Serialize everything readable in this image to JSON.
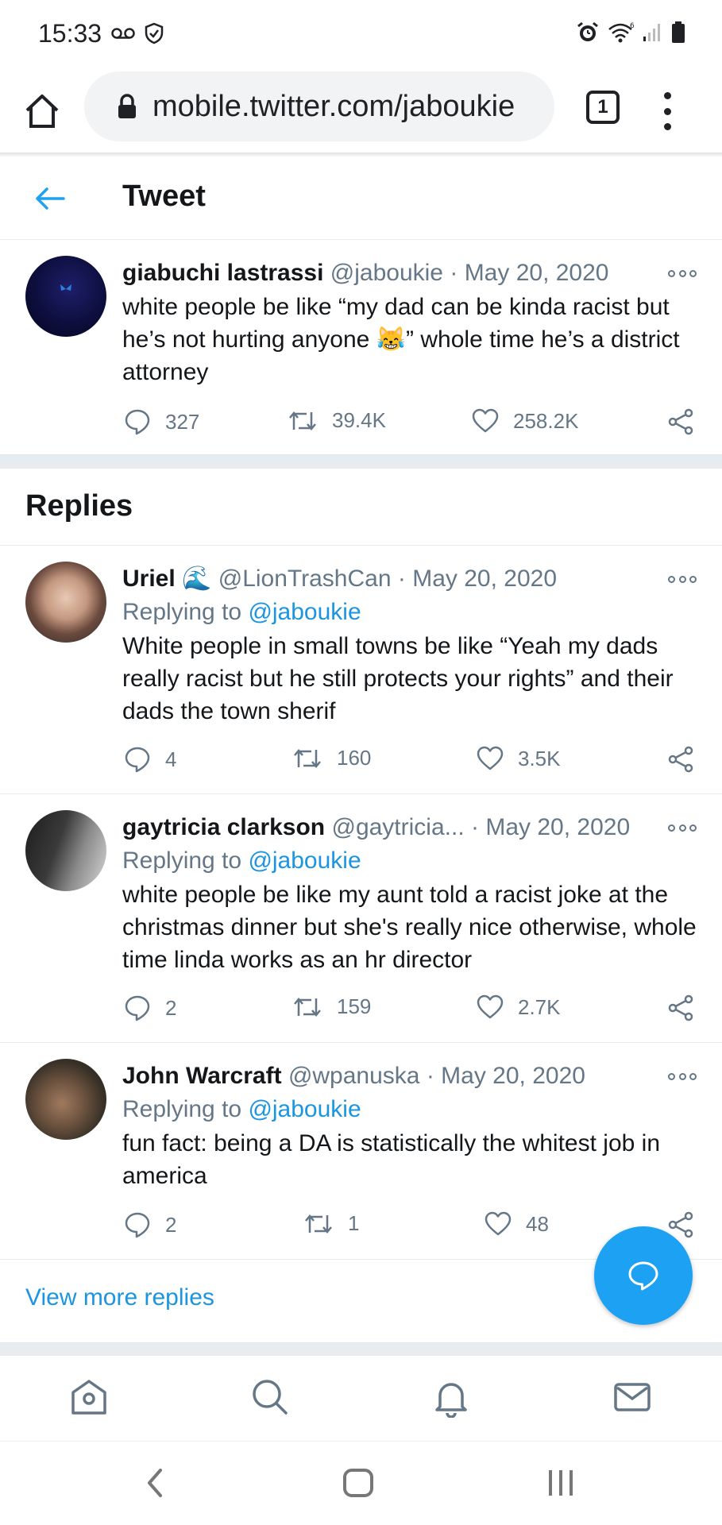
{
  "status_bar": {
    "time": "15:33",
    "icons": [
      "voicemail-icon",
      "shield-icon",
      "alarm-icon",
      "wifi-icon",
      "signal-icon",
      "battery-icon"
    ]
  },
  "browser": {
    "url": "mobile.twitter.com/jaboukie",
    "tab_count": "1"
  },
  "header": {
    "title": "Tweet"
  },
  "main_tweet": {
    "name": "giabuchi lastrassi",
    "handle": "@jaboukie",
    "sep": "·",
    "date": "May 20, 2020",
    "text_before_emoji": "white people be like “my dad can be kinda racist but he’s not hurting anyone ",
    "emoji": "😹",
    "text_after_emoji": "” whole time he’s a district attorney",
    "replies": "327",
    "retweets": "39.4K",
    "likes": "258.2K"
  },
  "replies_title": "Replies",
  "replies": [
    {
      "name": "Uriel",
      "emoji": "🌊",
      "handle": "@LionTrashCan",
      "sep": "·",
      "date": "May 20, 2020",
      "replying_prefix": "Replying to ",
      "replying_to": "@jaboukie",
      "text": "White people in small towns be like “Yeah my dads really racist but he still protects your rights” and their dads the town sherif",
      "replies": "4",
      "retweets": "160",
      "likes": "3.5K"
    },
    {
      "name": "gaytricia clarkson",
      "handle": "@gaytricia...",
      "sep": "·",
      "date": "May 20, 2020",
      "replying_prefix": "Replying to ",
      "replying_to": "@jaboukie",
      "text": "white people be like my aunt told a racist joke at the christmas dinner but she's really nice otherwise, whole time linda works as an hr director",
      "replies": "2",
      "retweets": "159",
      "likes": "2.7K"
    },
    {
      "name": "John Warcraft",
      "handle": "@wpanuska",
      "sep": "·",
      "date": "May 20, 2020",
      "replying_prefix": "Replying to ",
      "replying_to": "@jaboukie",
      "text": "fun fact: being a DA is statistically the whitest job in america",
      "replies": "2",
      "retweets": "1",
      "likes": "48"
    }
  ],
  "view_more": "View more replies",
  "colors": {
    "twitter_blue": "#1da1f2",
    "link_blue": "#1b95e0",
    "muted_gray": "#657786",
    "text_dark": "#14171a",
    "divider": "#e6ecf0"
  }
}
